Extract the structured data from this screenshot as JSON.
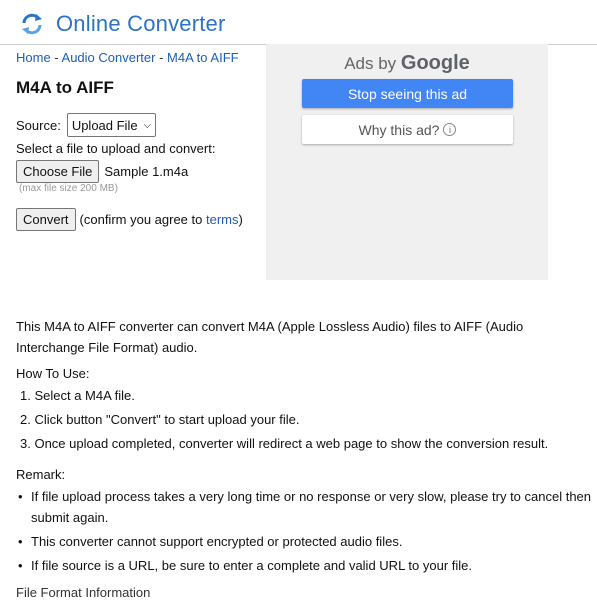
{
  "site": {
    "title": "Online Converter",
    "logo_icon": "refresh-arrows-icon"
  },
  "breadcrumb": [
    {
      "label": "Home"
    },
    {
      "label": "Audio Converter"
    },
    {
      "label": "M4A to AIFF"
    }
  ],
  "breadcrumb_sep": " - ",
  "page": {
    "heading": "M4A to AIFF"
  },
  "form": {
    "source_label": "Source:",
    "source_value": "Upload File",
    "select_file_label": "Select a file to upload and convert:",
    "choose_file_label": "Choose File",
    "file_name": "Sample 1.m4a",
    "max_size": "(max file size 200 MB)",
    "convert_label": "Convert",
    "confirm_prefix": "(confirm you agree to ",
    "terms_link": "terms",
    "confirm_suffix": ")"
  },
  "ad": {
    "ads_by": "Ads by",
    "google": "Google",
    "stop_label": "Stop seeing this ad",
    "why_label": "Why this ad?",
    "accent": "#4285f4"
  },
  "content": {
    "description": "This M4A to AIFF converter can convert M4A (Apple Lossless Audio) files to AIFF (Audio Interchange File Format) audio.",
    "howto_title": "How To Use:",
    "steps": [
      "1. Select a M4A file.",
      "2. Click button \"Convert\" to start upload your file.",
      "3. Once upload completed, converter will redirect a web page to show the conversion result."
    ],
    "remark_title": "Remark:",
    "remarks": [
      "If file upload process takes a very long time or no response or very slow, please try to cancel then submit again.",
      "This converter cannot support encrypted or protected audio files.",
      "If file source is a URL, be sure to enter a complete and valid URL to your file."
    ],
    "cut_text": "File Format Information"
  }
}
